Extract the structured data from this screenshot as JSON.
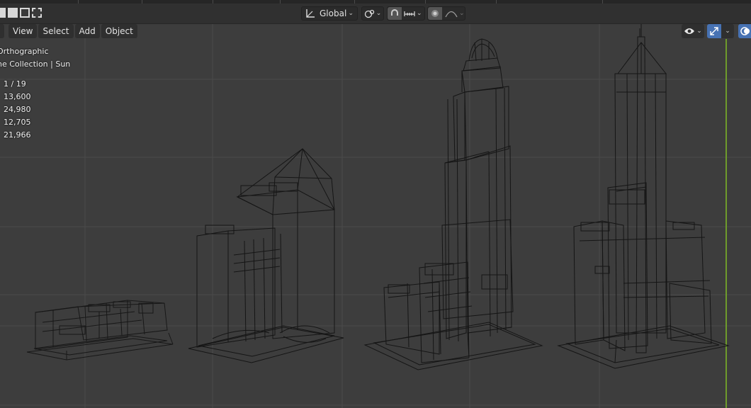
{
  "header": {
    "transform_orientation": "Global",
    "pivot_icon": "pivot-icon",
    "snap_icon": "snap-magnet-icon",
    "snap_target_icon": "snap-increment-icon",
    "proportional_icon": "proportional-edit-icon",
    "falloff_icon": "falloff-curve-icon"
  },
  "menu": {
    "view": "View",
    "select": "Select",
    "add": "Add",
    "object": "Object"
  },
  "viewport_info": {
    "projection": "Orthographic",
    "collection": "ne Collection | Sun"
  },
  "stats": [
    "1 / 19",
    "13,600",
    "24,980",
    "12,705",
    "21,966"
  ],
  "right_tools": {
    "visibility_icon": "eye-icon",
    "gizmo_icon": "gizmo-icon",
    "overlay_icon": "overlay-icon"
  },
  "colors": {
    "viewport_bg": "#3d3d3d",
    "grid": "#4a4a4a",
    "wire": "#0a0a0a",
    "y_axis": "#6e9c2b",
    "header_bg": "#303030",
    "active_tool": "#4772b3"
  }
}
